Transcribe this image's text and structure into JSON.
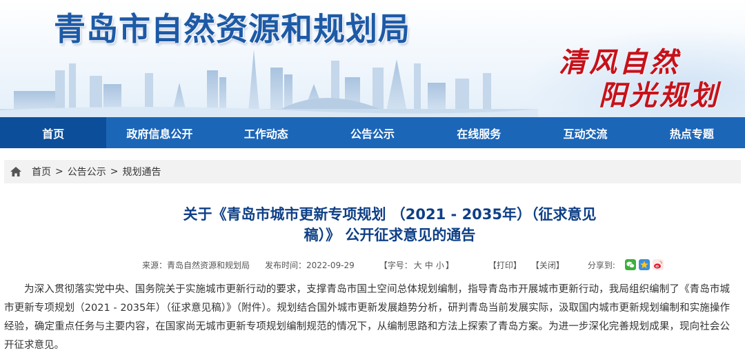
{
  "banner": {
    "title": "青岛市自然资源和规划局",
    "slogan_line1": "清风自然",
    "slogan_line2": "阳光规划"
  },
  "nav": {
    "items": [
      {
        "label": "首页",
        "active": true
      },
      {
        "label": "政府信息公开"
      },
      {
        "label": "工作动态"
      },
      {
        "label": "公告公示"
      },
      {
        "label": "在线服务"
      },
      {
        "label": "互动交流"
      },
      {
        "label": "热点专题"
      }
    ]
  },
  "breadcrumb": {
    "icon": "home-icon",
    "items": [
      "首页",
      "公告公示",
      "规划通告"
    ],
    "separator": ">"
  },
  "article": {
    "title": "关于《青岛市城市更新专项规划 （2021 - 2035年）（征求意见稿）》 公开征求意见的通告",
    "meta": {
      "source": "来源：青岛自然资源和规划局",
      "date": "发布时间：2022-09-29",
      "font_size_label": "【字号：",
      "font_size_large": "大",
      "font_size_medium": "中",
      "font_size_small": "小",
      "font_size_end": "】",
      "print": "【打印】",
      "close": "【关闭】",
      "share_label": "分享到:"
    },
    "body": "为深入贯彻落实党中央、国务院关于实施城市更新行动的要求，支撑青岛市国土空间总体规划编制，指导青岛市开展城市更新行动，我局组织编制了《青岛市城市更新专项规划（2021 - 2035年）（征求意见稿）》（附件）。规划结合国外城市更新发展趋势分析，研判青岛当前发展实际，汲取国内城市更新规划编制和实施操作经验，确定重点任务与主要内容，在国家尚无城市更新专项规划编制规范的情况下，从编制思路和方法上探索了青岛方案。为进一步深化完善规划成果，现向社会公开征求意见。"
  },
  "colors": {
    "nav_bg": "#1c66b8",
    "nav_active": "#0d4e9a",
    "title_blue": "#0e3f86",
    "slogan_red": "#c7111a"
  }
}
